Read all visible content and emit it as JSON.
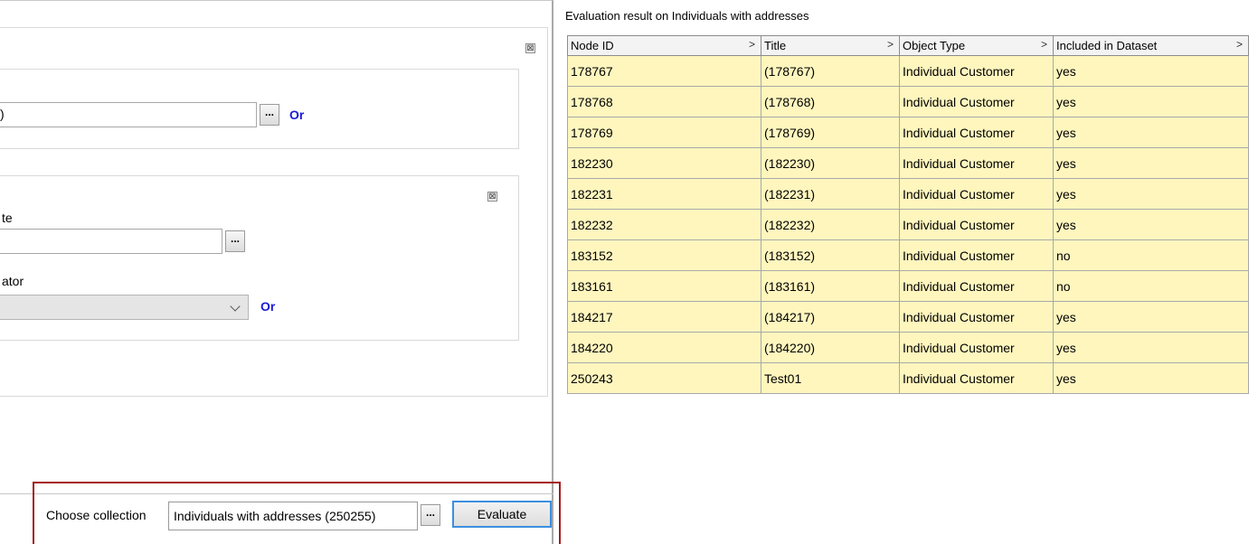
{
  "editor": {
    "group1": {
      "close_symbol": "⊠",
      "or_label": "Or",
      "browse_label": "..."
    },
    "group2": {
      "close_symbol": "⊠",
      "attribute_label_fragment": "te",
      "operator_label_fragment": "ator",
      "browse_label": "...",
      "or_label": "Or",
      "first_input_fragment": ")"
    }
  },
  "bottom_bar": {
    "choose_label": "Choose collection",
    "collection_value": "Individuals with addresses (250255)",
    "browse_label": "...",
    "evaluate_label": "Evaluate"
  },
  "results": {
    "title": "Evaluation result on Individuals with addresses",
    "columns": [
      {
        "label": "Node ID",
        "sort": ">"
      },
      {
        "label": "Title",
        "sort": ">"
      },
      {
        "label": "Object Type",
        "sort": ">"
      },
      {
        "label": "Included in Dataset",
        "sort": ">"
      }
    ],
    "rows": [
      [
        "178767",
        "(178767)",
        "Individual Customer",
        "yes"
      ],
      [
        "178768",
        "(178768)",
        "Individual Customer",
        "yes"
      ],
      [
        "178769",
        "(178769)",
        "Individual Customer",
        "yes"
      ],
      [
        "182230",
        "(182230)",
        "Individual Customer",
        "yes"
      ],
      [
        "182231",
        "(182231)",
        "Individual Customer",
        "yes"
      ],
      [
        "182232",
        "(182232)",
        "Individual Customer",
        "yes"
      ],
      [
        "183152",
        "(183152)",
        "Individual Customer",
        "no"
      ],
      [
        "183161",
        "(183161)",
        "Individual Customer",
        "no"
      ],
      [
        "184217",
        "(184217)",
        "Individual Customer",
        "yes"
      ],
      [
        "184220",
        "(184220)",
        "Individual Customer",
        "yes"
      ],
      [
        "250243",
        "Test01",
        "Individual Customer",
        "yes"
      ]
    ]
  },
  "colors": {
    "row_background": "#fff6be",
    "or_link": "#1a1ad6",
    "highlight_border": "#a61b1b",
    "evaluate_focus": "#3c8fe0"
  }
}
